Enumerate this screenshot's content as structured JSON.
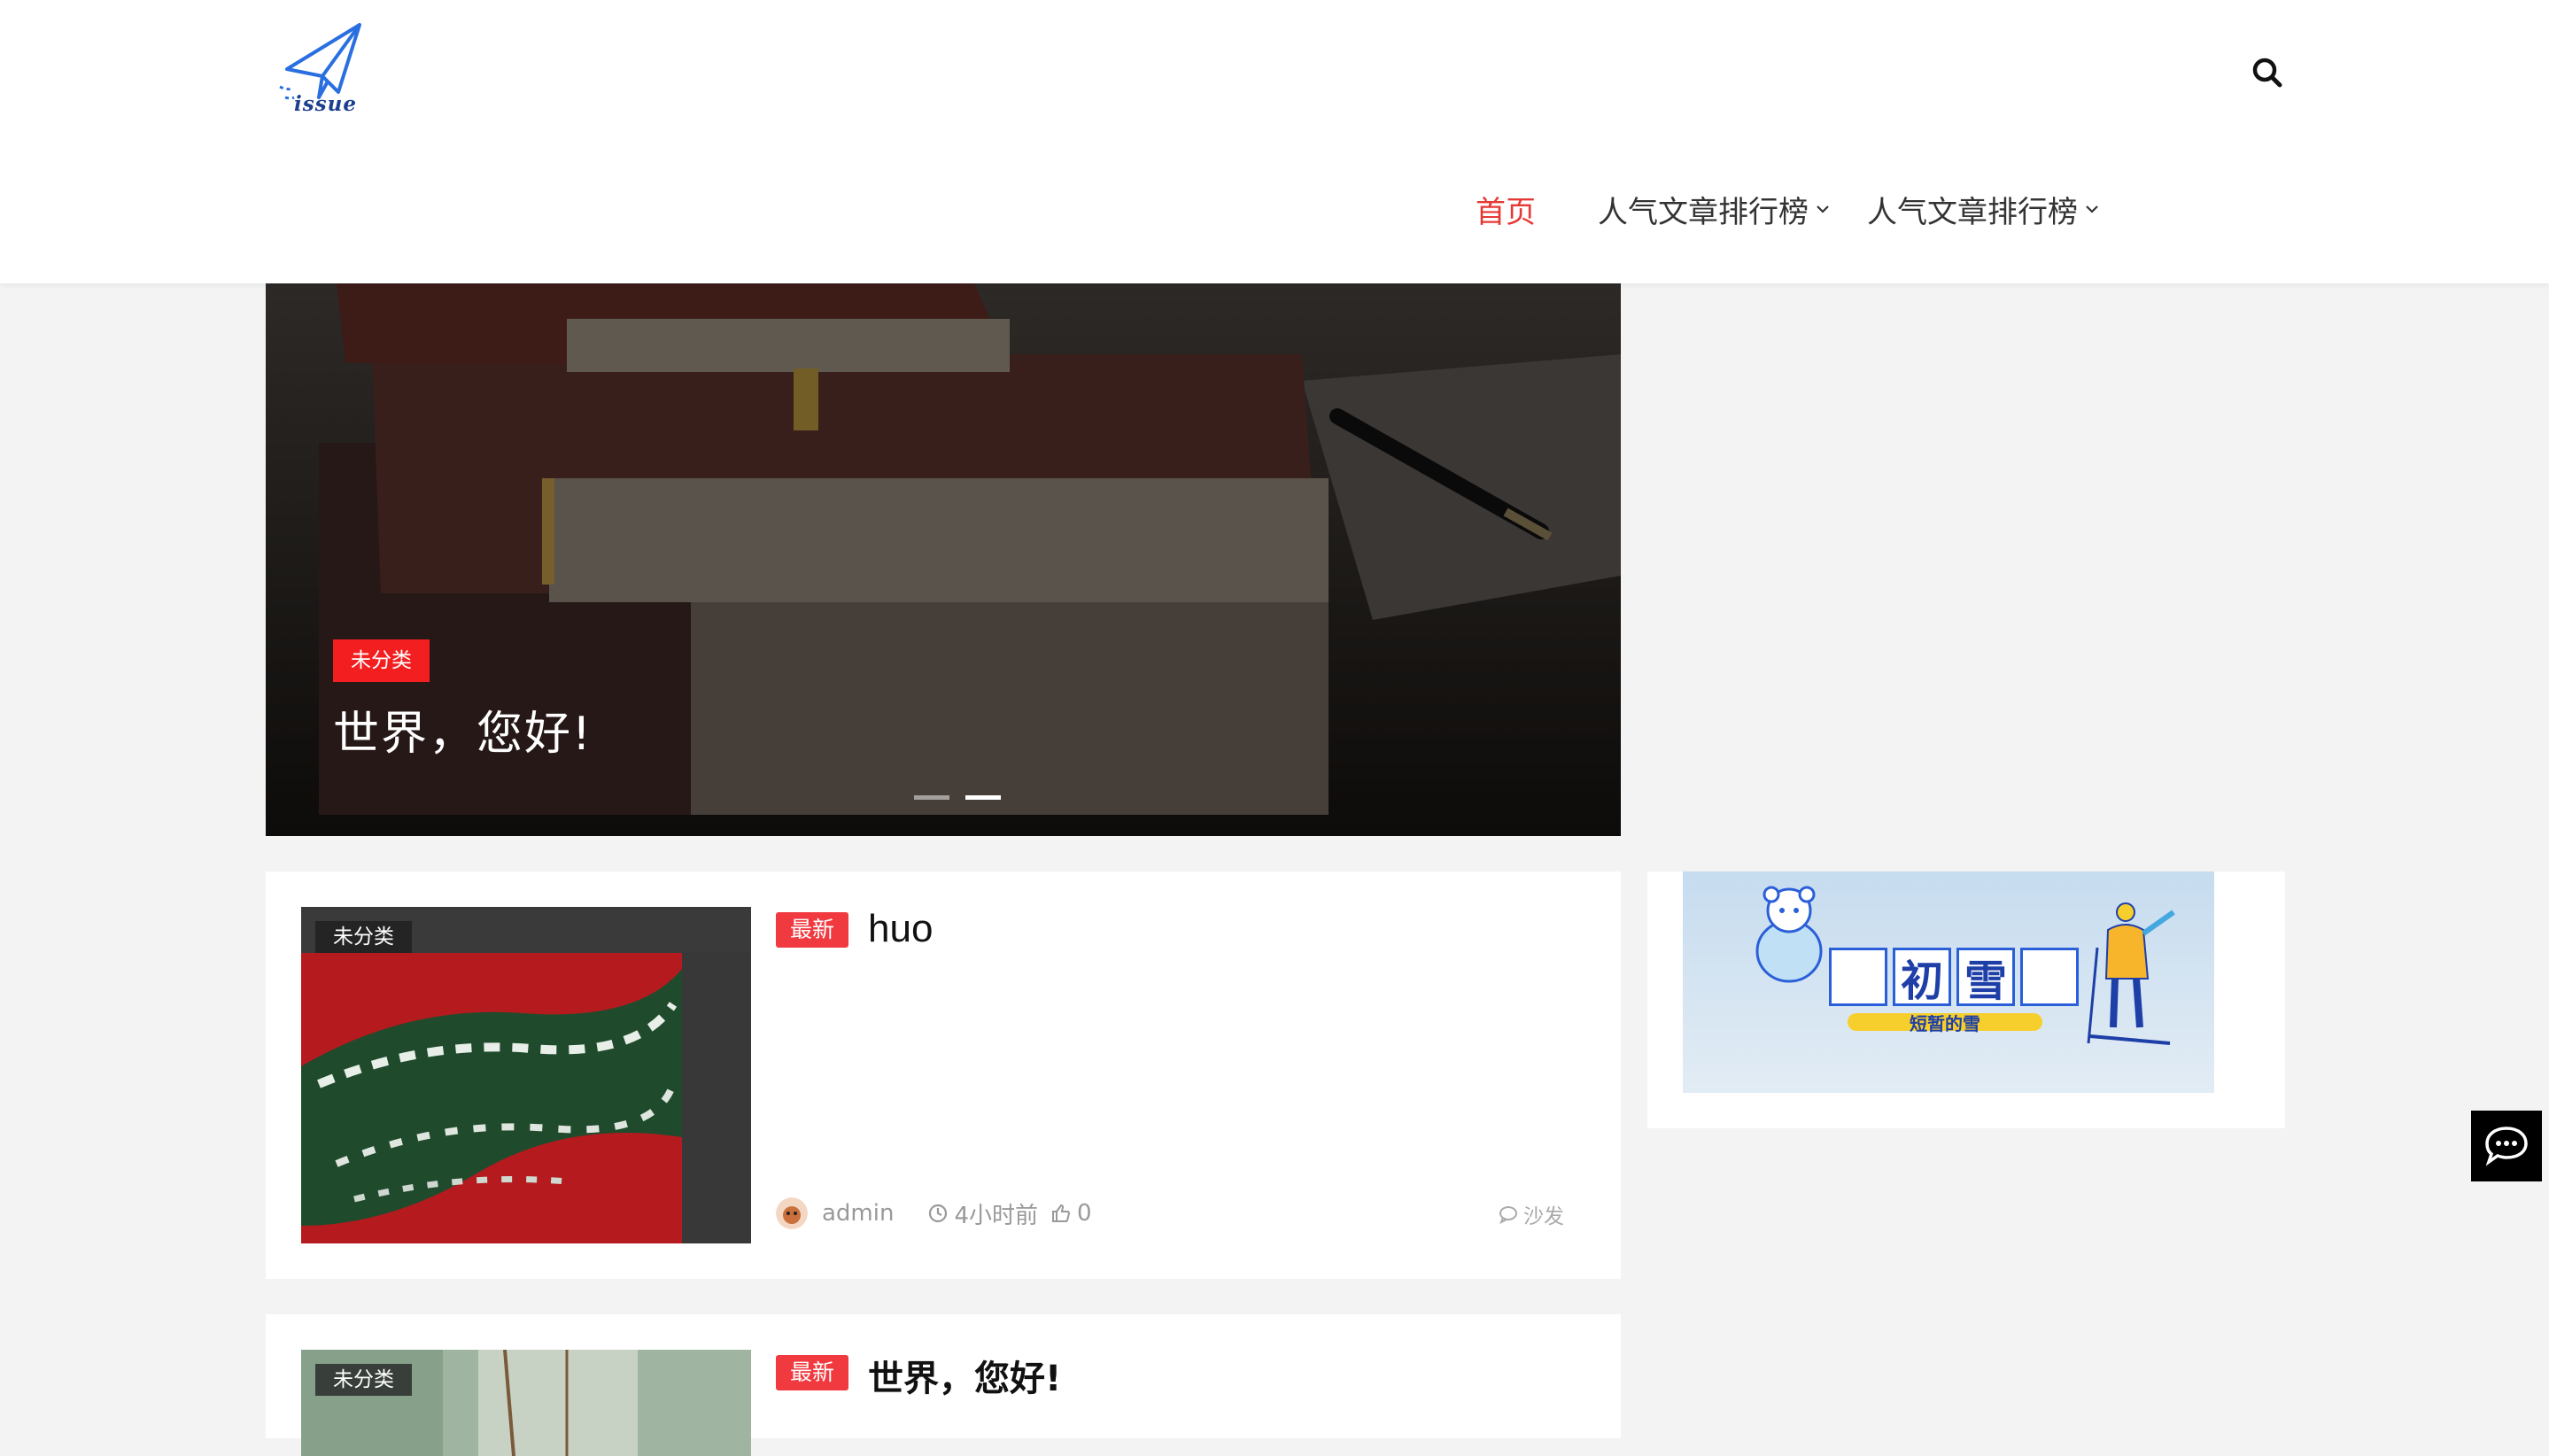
{
  "header": {
    "logo_text": "issue",
    "nav": [
      {
        "label": "首页",
        "active": true
      },
      {
        "label": "人气文章排行榜",
        "has_dropdown": true
      },
      {
        "label": "人气文章排行榜",
        "has_dropdown": true
      }
    ]
  },
  "slider": {
    "category": "未分类",
    "title": "世界，您好!",
    "dot_count": 2,
    "active_dot": 2
  },
  "posts": [
    {
      "category": "未分类",
      "badge": "最新",
      "title": "huo",
      "author": "admin",
      "time": "4小时前",
      "likes": "0",
      "comments": "沙发"
    },
    {
      "category": "未分类",
      "badge": "最新",
      "title": "世界，您好!"
    }
  ],
  "sidebar": {
    "banner_chars": [
      "初",
      "雪"
    ],
    "banner_sub": "短暂的雪"
  },
  "colors": {
    "accent": "#e53935",
    "badge": "#f03a3f",
    "category_tag": "#f21e20",
    "page_bg": "#f3f3f3"
  },
  "icons": [
    "paper-plane-logo",
    "search-icon",
    "chevron-down-icon",
    "clock-icon",
    "thumbs-up-icon",
    "comment-icon",
    "chat-icon"
  ]
}
